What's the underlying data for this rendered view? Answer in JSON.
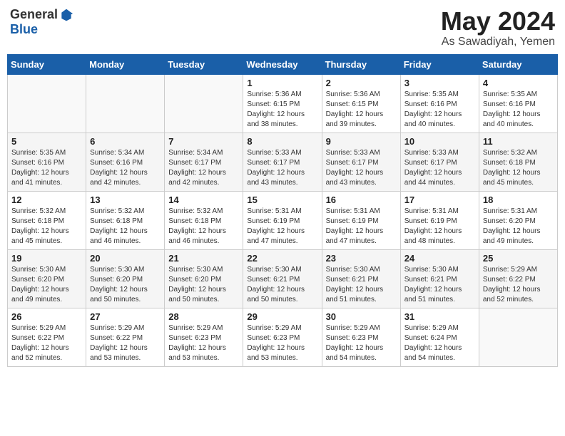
{
  "logo": {
    "general": "General",
    "blue": "Blue"
  },
  "title": {
    "month": "May 2024",
    "location": "As Sawadiyah, Yemen"
  },
  "headers": [
    "Sunday",
    "Monday",
    "Tuesday",
    "Wednesday",
    "Thursday",
    "Friday",
    "Saturday"
  ],
  "weeks": [
    [
      {
        "day": "",
        "info": ""
      },
      {
        "day": "",
        "info": ""
      },
      {
        "day": "",
        "info": ""
      },
      {
        "day": "1",
        "info": "Sunrise: 5:36 AM\nSunset: 6:15 PM\nDaylight: 12 hours\nand 38 minutes."
      },
      {
        "day": "2",
        "info": "Sunrise: 5:36 AM\nSunset: 6:15 PM\nDaylight: 12 hours\nand 39 minutes."
      },
      {
        "day": "3",
        "info": "Sunrise: 5:35 AM\nSunset: 6:16 PM\nDaylight: 12 hours\nand 40 minutes."
      },
      {
        "day": "4",
        "info": "Sunrise: 5:35 AM\nSunset: 6:16 PM\nDaylight: 12 hours\nand 40 minutes."
      }
    ],
    [
      {
        "day": "5",
        "info": "Sunrise: 5:35 AM\nSunset: 6:16 PM\nDaylight: 12 hours\nand 41 minutes."
      },
      {
        "day": "6",
        "info": "Sunrise: 5:34 AM\nSunset: 6:16 PM\nDaylight: 12 hours\nand 42 minutes."
      },
      {
        "day": "7",
        "info": "Sunrise: 5:34 AM\nSunset: 6:17 PM\nDaylight: 12 hours\nand 42 minutes."
      },
      {
        "day": "8",
        "info": "Sunrise: 5:33 AM\nSunset: 6:17 PM\nDaylight: 12 hours\nand 43 minutes."
      },
      {
        "day": "9",
        "info": "Sunrise: 5:33 AM\nSunset: 6:17 PM\nDaylight: 12 hours\nand 43 minutes."
      },
      {
        "day": "10",
        "info": "Sunrise: 5:33 AM\nSunset: 6:17 PM\nDaylight: 12 hours\nand 44 minutes."
      },
      {
        "day": "11",
        "info": "Sunrise: 5:32 AM\nSunset: 6:18 PM\nDaylight: 12 hours\nand 45 minutes."
      }
    ],
    [
      {
        "day": "12",
        "info": "Sunrise: 5:32 AM\nSunset: 6:18 PM\nDaylight: 12 hours\nand 45 minutes."
      },
      {
        "day": "13",
        "info": "Sunrise: 5:32 AM\nSunset: 6:18 PM\nDaylight: 12 hours\nand 46 minutes."
      },
      {
        "day": "14",
        "info": "Sunrise: 5:32 AM\nSunset: 6:18 PM\nDaylight: 12 hours\nand 46 minutes."
      },
      {
        "day": "15",
        "info": "Sunrise: 5:31 AM\nSunset: 6:19 PM\nDaylight: 12 hours\nand 47 minutes."
      },
      {
        "day": "16",
        "info": "Sunrise: 5:31 AM\nSunset: 6:19 PM\nDaylight: 12 hours\nand 47 minutes."
      },
      {
        "day": "17",
        "info": "Sunrise: 5:31 AM\nSunset: 6:19 PM\nDaylight: 12 hours\nand 48 minutes."
      },
      {
        "day": "18",
        "info": "Sunrise: 5:31 AM\nSunset: 6:20 PM\nDaylight: 12 hours\nand 49 minutes."
      }
    ],
    [
      {
        "day": "19",
        "info": "Sunrise: 5:30 AM\nSunset: 6:20 PM\nDaylight: 12 hours\nand 49 minutes."
      },
      {
        "day": "20",
        "info": "Sunrise: 5:30 AM\nSunset: 6:20 PM\nDaylight: 12 hours\nand 50 minutes."
      },
      {
        "day": "21",
        "info": "Sunrise: 5:30 AM\nSunset: 6:20 PM\nDaylight: 12 hours\nand 50 minutes."
      },
      {
        "day": "22",
        "info": "Sunrise: 5:30 AM\nSunset: 6:21 PM\nDaylight: 12 hours\nand 50 minutes."
      },
      {
        "day": "23",
        "info": "Sunrise: 5:30 AM\nSunset: 6:21 PM\nDaylight: 12 hours\nand 51 minutes."
      },
      {
        "day": "24",
        "info": "Sunrise: 5:30 AM\nSunset: 6:21 PM\nDaylight: 12 hours\nand 51 minutes."
      },
      {
        "day": "25",
        "info": "Sunrise: 5:29 AM\nSunset: 6:22 PM\nDaylight: 12 hours\nand 52 minutes."
      }
    ],
    [
      {
        "day": "26",
        "info": "Sunrise: 5:29 AM\nSunset: 6:22 PM\nDaylight: 12 hours\nand 52 minutes."
      },
      {
        "day": "27",
        "info": "Sunrise: 5:29 AM\nSunset: 6:22 PM\nDaylight: 12 hours\nand 53 minutes."
      },
      {
        "day": "28",
        "info": "Sunrise: 5:29 AM\nSunset: 6:23 PM\nDaylight: 12 hours\nand 53 minutes."
      },
      {
        "day": "29",
        "info": "Sunrise: 5:29 AM\nSunset: 6:23 PM\nDaylight: 12 hours\nand 53 minutes."
      },
      {
        "day": "30",
        "info": "Sunrise: 5:29 AM\nSunset: 6:23 PM\nDaylight: 12 hours\nand 54 minutes."
      },
      {
        "day": "31",
        "info": "Sunrise: 5:29 AM\nSunset: 6:24 PM\nDaylight: 12 hours\nand 54 minutes."
      },
      {
        "day": "",
        "info": ""
      }
    ]
  ]
}
